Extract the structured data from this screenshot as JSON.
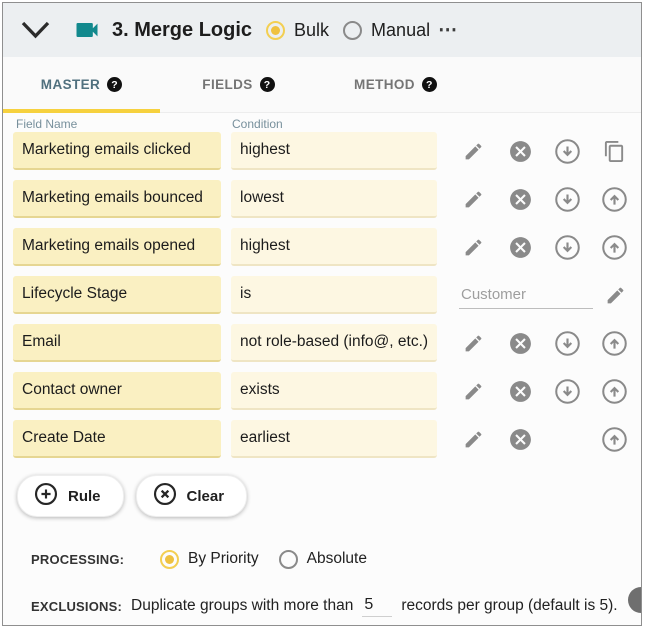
{
  "header": {
    "title": "3. Merge Logic",
    "more_icon": "⋯",
    "mode": {
      "options": [
        {
          "label": "Bulk",
          "selected": true
        },
        {
          "label": "Manual",
          "selected": false
        }
      ]
    }
  },
  "tabs": [
    {
      "label": "MASTER",
      "active": true,
      "help_icon": "?"
    },
    {
      "label": "FIELDS",
      "active": false,
      "help_icon": "?"
    },
    {
      "label": "METHOD",
      "active": false,
      "help_icon": "?"
    }
  ],
  "table": {
    "columns": [
      "Field Name",
      "Condition"
    ],
    "rows": [
      {
        "field_name": "Marketing emails clicked",
        "condition": "highest",
        "actions": [
          "edit",
          "remove",
          "move-down",
          "duplicate"
        ]
      },
      {
        "field_name": "Marketing emails bounced",
        "condition": "lowest",
        "actions": [
          "edit",
          "remove",
          "move-down",
          "move-up"
        ]
      },
      {
        "field_name": "Marketing emails opened",
        "condition": "highest",
        "actions": [
          "edit",
          "remove",
          "move-down",
          "move-up"
        ]
      },
      {
        "field_name": "Lifecycle Stage",
        "condition": "is",
        "value": "Customer",
        "actions": [
          "edit"
        ]
      },
      {
        "field_name": "Email",
        "condition": "not role-based (info@, etc.)",
        "actions": [
          "edit",
          "remove",
          "move-down",
          "move-up"
        ]
      },
      {
        "field_name": "Contact owner",
        "condition": "exists",
        "actions": [
          "edit",
          "remove",
          "move-down",
          "move-up"
        ]
      },
      {
        "field_name": "Create Date",
        "condition": "earliest",
        "actions": [
          "edit",
          "remove",
          "move-up"
        ]
      }
    ]
  },
  "buttons": {
    "rule": "Rule",
    "clear": "Clear"
  },
  "processing": {
    "label": "PROCESSING:",
    "options": [
      {
        "label": "By Priority",
        "selected": true
      },
      {
        "label": "Absolute",
        "selected": false
      }
    ]
  },
  "exclusions": {
    "label": "EXCLUSIONS:",
    "before": "Duplicate groups with more than",
    "value": "5",
    "after": "records per group (default is 5)."
  },
  "colors": {
    "header_bg": "#ECEFF1",
    "accent_yellow": "#F6D13E",
    "field_yellow": "#FAF0C2",
    "condition_cream": "#FDF7E2",
    "teal_icon": "#12898D",
    "icon_gray": "#8A8A8A",
    "active_tab_text": "#50707E",
    "radio_selected": "#EFC13F"
  }
}
